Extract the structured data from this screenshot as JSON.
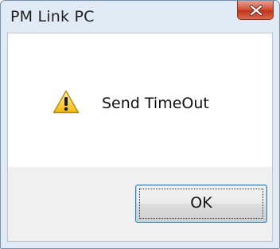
{
  "window": {
    "title": "PM Link PC"
  },
  "dialog": {
    "icon": "warning-icon",
    "message": "Send TimeOut",
    "ok_label": "OK"
  },
  "colors": {
    "frame": "#e1ebf6",
    "close_button": "#c7432b",
    "button_area": "#f0f0f0",
    "focus_border": "#3c7fb1"
  }
}
